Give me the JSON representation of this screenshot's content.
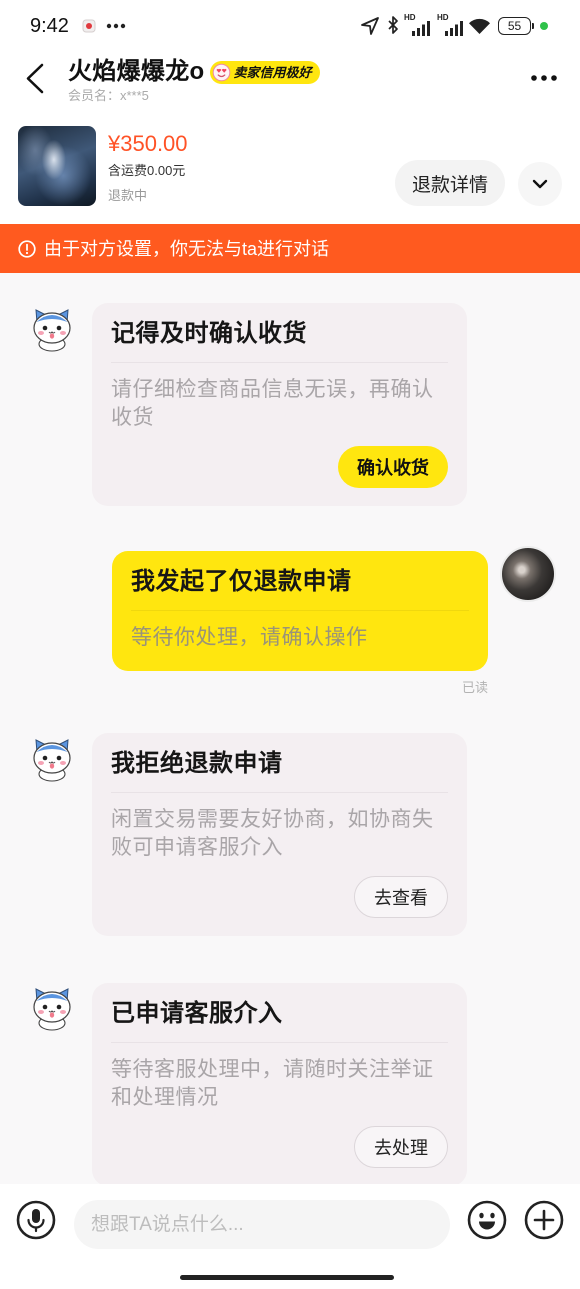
{
  "status_bar": {
    "time": "9:42",
    "signal_labels": [
      "HD",
      "HD"
    ],
    "battery": "55",
    "icons": [
      "app-notification-icon",
      "more-dots-icon",
      "location-arrow-icon",
      "bluetooth-icon",
      "signal-icon",
      "signal-icon",
      "wifi-icon",
      "battery-icon",
      "charging-dot-icon"
    ]
  },
  "header": {
    "back_icon": "chevron-left-icon",
    "title": "火焰爆爆龙o",
    "badge_icon": "heart-eyes-face-icon",
    "badge": "卖家信用极好",
    "member_label": "会员名：x***5",
    "more_icon": "more-dots-icon"
  },
  "product": {
    "price": "¥350.00",
    "shipping": "含运费0.00元",
    "status": "退款中",
    "refund_detail_button": "退款详情",
    "expand_icon": "chevron-down-icon"
  },
  "notice": {
    "icon": "info-circle-icon",
    "text": "由于对方设置，你无法与ta进行对话"
  },
  "messages": [
    {
      "title": "记得及时确认收货",
      "body": "请仔细检查商品信息无误，再确认收货",
      "button": "确认收货"
    },
    {
      "title": "我发起了仅退款申请",
      "body": "等待你处理，请确认操作",
      "read_status": "已读"
    },
    {
      "title": "我拒绝退款申请",
      "body": "闲置交易需要友好协商，如协商失败可申请客服介入",
      "button": "去查看"
    },
    {
      "title": "已申请客服介入",
      "body": "等待客服处理中，请随时关注举证和处理情况",
      "button": "去处理"
    }
  ],
  "input_bar": {
    "voice_icon": "microphone-icon",
    "placeholder": "想跟TA说点什么...",
    "emoji_icon": "smile-icon",
    "more_icon": "plus-icon"
  },
  "colors": {
    "brand_yellow": "#ffe60f",
    "price": "#ff5226",
    "notice_bg": "#ff5a1f",
    "card_bg": "#f4eff2",
    "chat_bg": "#f9f8f9"
  }
}
